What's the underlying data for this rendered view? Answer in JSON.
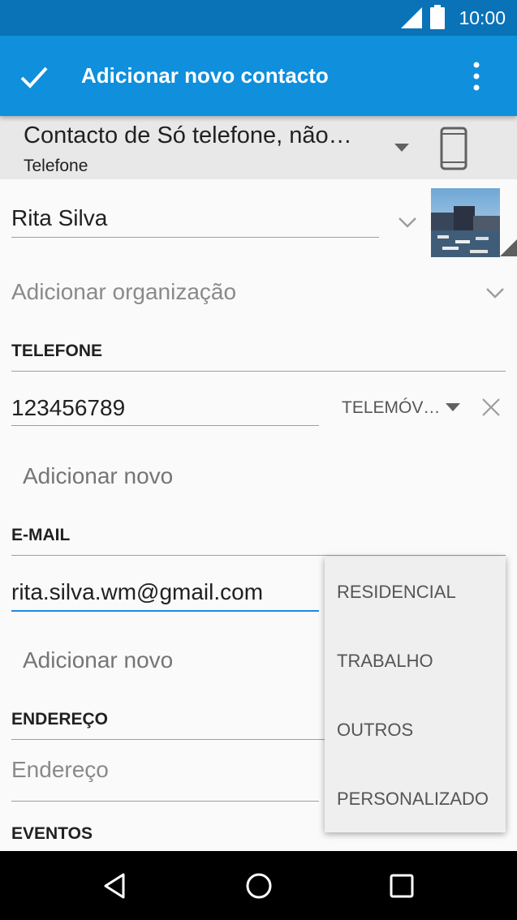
{
  "status_bar": {
    "time": "10:00"
  },
  "app_bar": {
    "title": "Adicionar novo contacto"
  },
  "account": {
    "name": "Contacto de Só telefone, não…",
    "type": "Telefone"
  },
  "name_field": {
    "value": "Rita Silva"
  },
  "organization": {
    "placeholder": "Adicionar organização"
  },
  "phone_section": {
    "title": "TELEFONE",
    "number": "123456789",
    "type": "TELEMÓV…",
    "add_new": "Adicionar novo"
  },
  "email_section": {
    "title": "E-MAIL",
    "value": "rita.silva.wm@gmail.com",
    "add_new": "Adicionar novo"
  },
  "address_section": {
    "title": "ENDEREÇO",
    "placeholder": "Endereço"
  },
  "events_section": {
    "title": "EVENTOS"
  },
  "email_type_menu": {
    "options": [
      "RESIDENCIAL",
      "TRABALHO",
      "OUTROS",
      "PERSONALIZADO"
    ]
  },
  "colors": {
    "status_bar": "#0a73b8",
    "app_bar": "#0f8fdc",
    "focus_accent": "#1e88e5"
  }
}
